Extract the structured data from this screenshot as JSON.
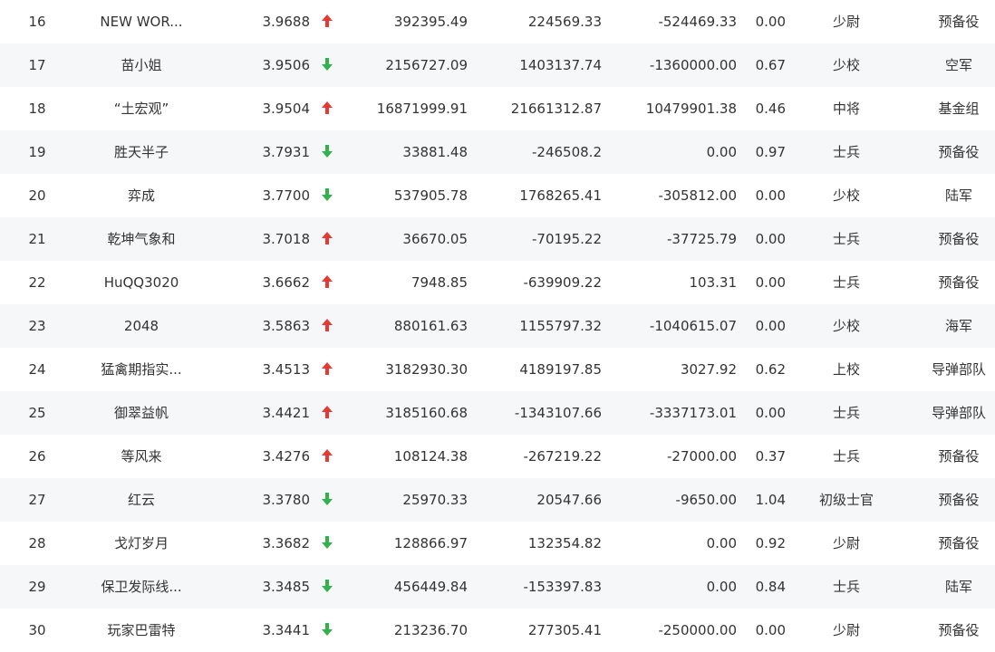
{
  "colors": {
    "up": "#e53935",
    "down": "#2fb44a"
  },
  "rows": [
    {
      "rank": "16",
      "name": "NEW WOR...",
      "score": "3.9688",
      "trend": "up",
      "v1": "392395.49",
      "v2": "224569.33",
      "v3": "-524469.33",
      "ratio": "0.00",
      "title": "少尉",
      "branch": "预备役"
    },
    {
      "rank": "17",
      "name": "苗小姐",
      "score": "3.9506",
      "trend": "down",
      "v1": "2156727.09",
      "v2": "1403137.74",
      "v3": "-1360000.00",
      "ratio": "0.67",
      "title": "少校",
      "branch": "空军"
    },
    {
      "rank": "18",
      "name": "“土宏观”",
      "score": "3.9504",
      "trend": "up",
      "v1": "16871999.91",
      "v2": "21661312.87",
      "v3": "10479901.38",
      "ratio": "0.46",
      "title": "中将",
      "branch": "基金组"
    },
    {
      "rank": "19",
      "name": "胜天半子",
      "score": "3.7931",
      "trend": "down",
      "v1": "33881.48",
      "v2": "-246508.2",
      "v3": "0.00",
      "ratio": "0.97",
      "title": "士兵",
      "branch": "预备役"
    },
    {
      "rank": "20",
      "name": "弈成",
      "score": "3.7700",
      "trend": "down",
      "v1": "537905.78",
      "v2": "1768265.41",
      "v3": "-305812.00",
      "ratio": "0.00",
      "title": "少校",
      "branch": "陆军"
    },
    {
      "rank": "21",
      "name": "乾坤气象和",
      "score": "3.7018",
      "trend": "up",
      "v1": "36670.05",
      "v2": "-70195.22",
      "v3": "-37725.79",
      "ratio": "0.00",
      "title": "士兵",
      "branch": "预备役"
    },
    {
      "rank": "22",
      "name": "HuQQ3020",
      "score": "3.6662",
      "trend": "up",
      "v1": "7948.85",
      "v2": "-639909.22",
      "v3": "103.31",
      "ratio": "0.00",
      "title": "士兵",
      "branch": "预备役"
    },
    {
      "rank": "23",
      "name": "2048",
      "score": "3.5863",
      "trend": "up",
      "v1": "880161.63",
      "v2": "1155797.32",
      "v3": "-1040615.07",
      "ratio": "0.00",
      "title": "少校",
      "branch": "海军"
    },
    {
      "rank": "24",
      "name": "猛禽期指实...",
      "score": "3.4513",
      "trend": "up",
      "v1": "3182930.30",
      "v2": "4189197.85",
      "v3": "3027.92",
      "ratio": "0.62",
      "title": "上校",
      "branch": "导弹部队"
    },
    {
      "rank": "25",
      "name": "御翠益帆",
      "score": "3.4421",
      "trend": "up",
      "v1": "3185160.68",
      "v2": "-1343107.66",
      "v3": "-3337173.01",
      "ratio": "0.00",
      "title": "士兵",
      "branch": "导弹部队"
    },
    {
      "rank": "26",
      "name": "等风来",
      "score": "3.4276",
      "trend": "up",
      "v1": "108124.38",
      "v2": "-267219.22",
      "v3": "-27000.00",
      "ratio": "0.37",
      "title": "士兵",
      "branch": "预备役"
    },
    {
      "rank": "27",
      "name": "红云",
      "score": "3.3780",
      "trend": "down",
      "v1": "25970.33",
      "v2": "20547.66",
      "v3": "-9650.00",
      "ratio": "1.04",
      "title": "初级士官",
      "branch": "预备役"
    },
    {
      "rank": "28",
      "name": "戈灯岁月",
      "score": "3.3682",
      "trend": "down",
      "v1": "128866.97",
      "v2": "132354.82",
      "v3": "0.00",
      "ratio": "0.92",
      "title": "少尉",
      "branch": "预备役"
    },
    {
      "rank": "29",
      "name": "保卫发际线...",
      "score": "3.3485",
      "trend": "down",
      "v1": "456449.84",
      "v2": "-153397.83",
      "v3": "0.00",
      "ratio": "0.84",
      "title": "士兵",
      "branch": "陆军"
    },
    {
      "rank": "30",
      "name": "玩家巴雷特",
      "score": "3.3441",
      "trend": "down",
      "v1": "213236.70",
      "v2": "277305.41",
      "v3": "-250000.00",
      "ratio": "0.00",
      "title": "少尉",
      "branch": "预备役"
    }
  ]
}
